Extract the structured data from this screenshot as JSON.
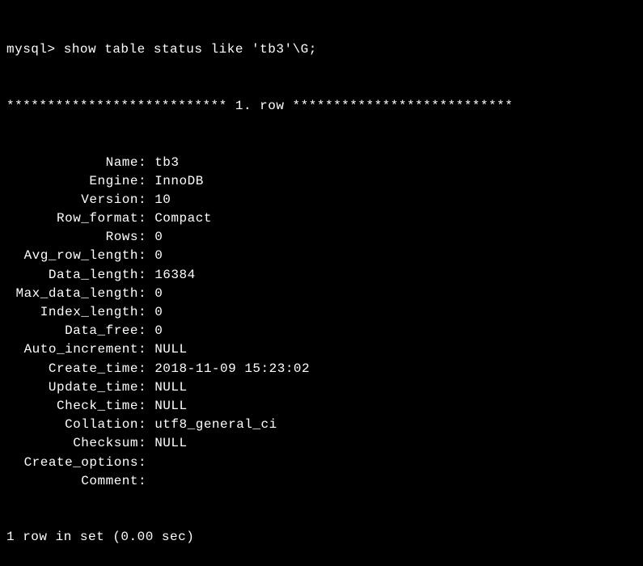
{
  "prompt": "mysql> ",
  "command": "show table status like 'tb3'\\G;",
  "separator": "*************************** 1. row ***************************",
  "fields": [
    {
      "label": "Name",
      "value": "tb3"
    },
    {
      "label": "Engine",
      "value": "InnoDB"
    },
    {
      "label": "Version",
      "value": "10"
    },
    {
      "label": "Row_format",
      "value": "Compact"
    },
    {
      "label": "Rows",
      "value": "0"
    },
    {
      "label": "Avg_row_length",
      "value": "0"
    },
    {
      "label": "Data_length",
      "value": "16384"
    },
    {
      "label": "Max_data_length",
      "value": "0"
    },
    {
      "label": "Index_length",
      "value": "0"
    },
    {
      "label": "Data_free",
      "value": "0"
    },
    {
      "label": "Auto_increment",
      "value": "NULL"
    },
    {
      "label": "Create_time",
      "value": "2018-11-09 15:23:02"
    },
    {
      "label": "Update_time",
      "value": "NULL"
    },
    {
      "label": "Check_time",
      "value": "NULL"
    },
    {
      "label": "Collation",
      "value": "utf8_general_ci"
    },
    {
      "label": "Checksum",
      "value": "NULL"
    },
    {
      "label": "Create_options",
      "value": ""
    },
    {
      "label": "Comment",
      "value": ""
    }
  ],
  "footer": "1 row in set (0.00 sec)"
}
